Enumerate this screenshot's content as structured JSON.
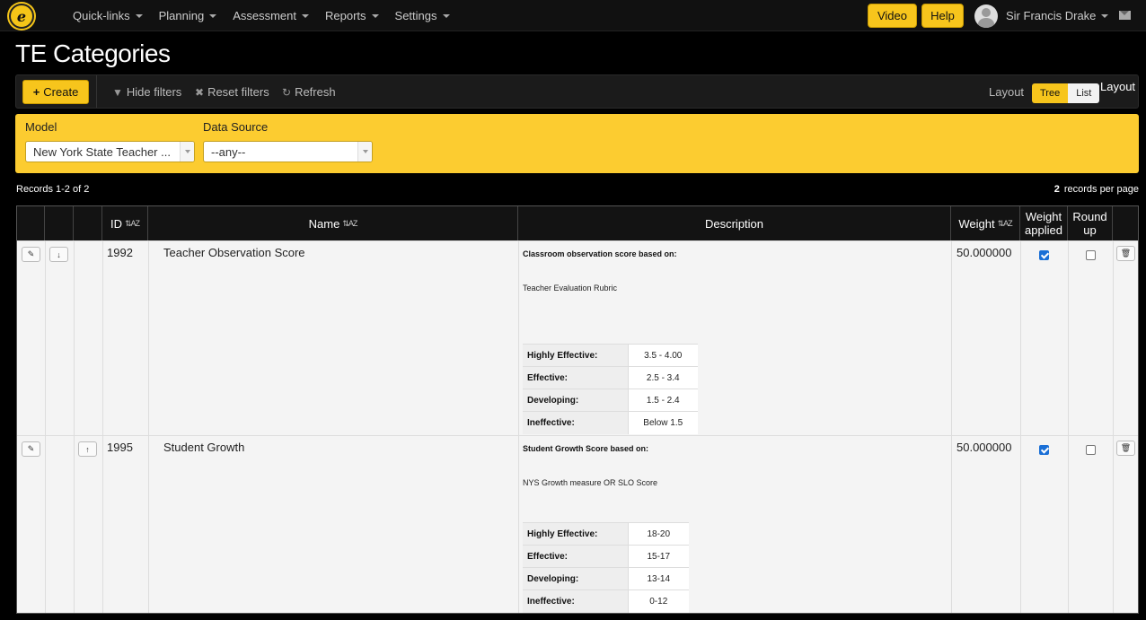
{
  "nav": {
    "logo_letter": "e",
    "menu": [
      "Quick-links",
      "Planning",
      "Assessment",
      "Reports",
      "Settings"
    ],
    "video_label": "Video",
    "help_label": "Help",
    "user_name": "Sir Francis Drake"
  },
  "page": {
    "title": "TE Categories"
  },
  "toolbar": {
    "create_label": "Create",
    "hide_filters_label": "Hide filters",
    "reset_filters_label": "Reset filters",
    "refresh_label": "Refresh",
    "layout_label": "Layout",
    "layout_tree": "Tree",
    "layout_list": "List",
    "layout_side_label": "Layout"
  },
  "filters": {
    "model_label": "Model",
    "model_value": "New York State Teacher ...",
    "source_label": "Data Source",
    "source_value": "--any--"
  },
  "records": {
    "info": "Records 1-2 of 2",
    "per_page_count": "2",
    "per_page_label": "records per page"
  },
  "table": {
    "headers": {
      "id": "ID",
      "name": "Name",
      "description": "Description",
      "weight": "Weight",
      "weight_applied_1": "Weight",
      "weight_applied_2": "applied",
      "round_up_1": "Round",
      "round_up_2": "up"
    },
    "rows": [
      {
        "id": "1992",
        "name": "Teacher Observation Score",
        "desc_title": "Classroom observation score based on:",
        "desc_sub": "Teacher Evaluation Rubric",
        "ratings": [
          {
            "label": "Highly Effective:",
            "value": "3.5 - 4.00"
          },
          {
            "label": "Effective:",
            "value": "2.5 - 3.4"
          },
          {
            "label": "Developing:",
            "value": "1.5 - 2.4"
          },
          {
            "label": "Ineffective:",
            "value": "Below 1.5"
          }
        ],
        "weight": "50.000000",
        "weight_applied": true,
        "round_up": false
      },
      {
        "id": "1995",
        "name": "Student Growth",
        "desc_title": "Student Growth Score based on:",
        "desc_sub": "NYS Growth measure  OR  SLO Score",
        "ratings": [
          {
            "label": "Highly Effective:",
            "value": "18-20"
          },
          {
            "label": "Effective:",
            "value": "15-17"
          },
          {
            "label": "Developing:",
            "value": "13-14"
          },
          {
            "label": "Ineffective:",
            "value": "0-12"
          }
        ],
        "weight": "50.000000",
        "weight_applied": true,
        "round_up": false
      }
    ]
  },
  "icons": {
    "edit": "pencil-icon",
    "move_down": "arrow-down-icon",
    "move_up": "arrow-up-icon",
    "delete": "trash-icon",
    "filter": "filter-icon",
    "reset": "times-icon",
    "refresh": "refresh-icon",
    "mail": "envelope-icon"
  },
  "colors": {
    "accent": "#f7c51c",
    "filter_panel": "#fccc30",
    "navbar": "#111111",
    "checkbox_on": "#1a6fd6"
  }
}
